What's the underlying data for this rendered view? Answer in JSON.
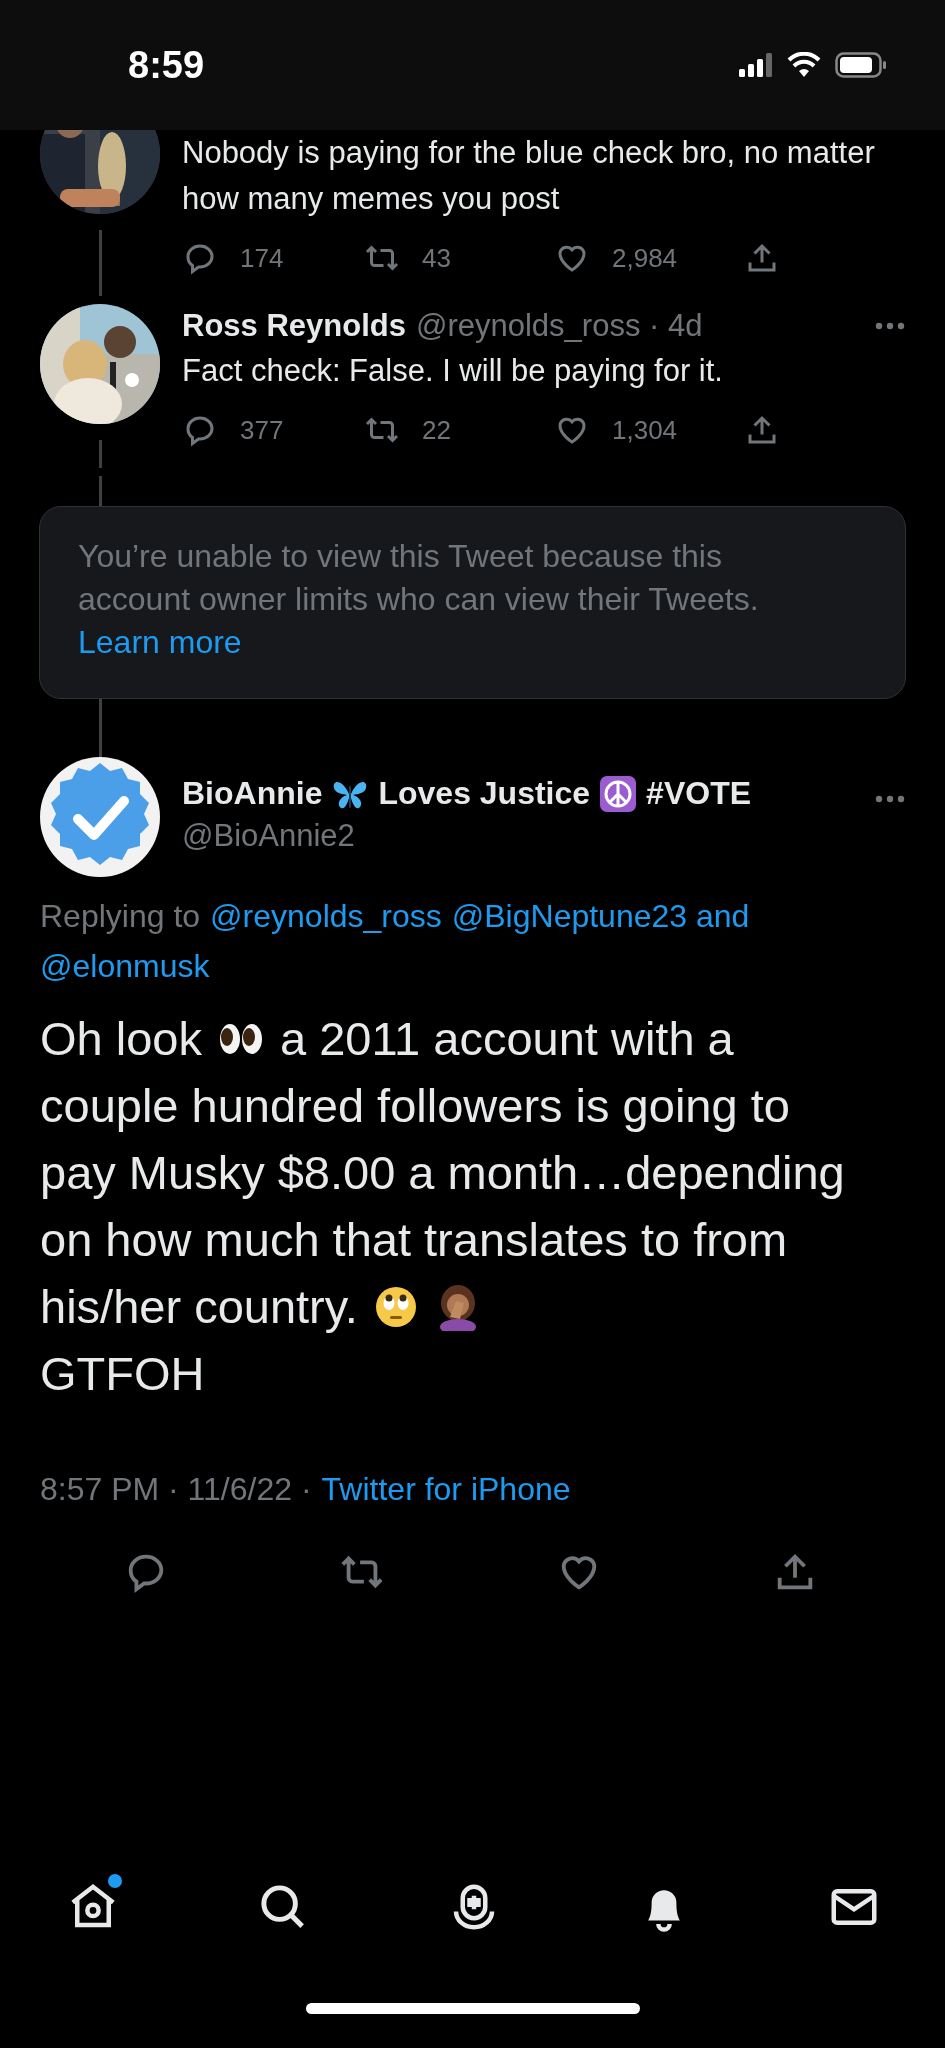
{
  "status_bar": {
    "time": "8:59"
  },
  "thread": [
    {
      "kind": "cut",
      "text": "Nobody is paying for the blue check bro, no matter how many memes you post",
      "replies": "174",
      "retweets": "43",
      "likes": "2,984"
    },
    {
      "kind": "full",
      "name": "Ross Reynolds",
      "meta": "@reynolds_ross · 4d",
      "text": "Fact check: False. I will be paying for it.",
      "replies": "377",
      "retweets": "22",
      "likes": "1,304"
    }
  ],
  "notice": {
    "text": "You’re unable to view this Tweet because this account owner limits who can view their Tweets.",
    "link": "Learn more"
  },
  "main_tweet": {
    "name_parts": [
      {
        "kind": "text",
        "text": "BioAnnie"
      },
      {
        "kind": "butterfly"
      },
      {
        "kind": "text",
        "text": "Loves Justice"
      },
      {
        "kind": "peace"
      },
      {
        "kind": "text",
        "text": "#VOTE"
      }
    ],
    "handle": "@BioAnnie2",
    "replying_label": "Replying to",
    "mentions": [
      "@reynolds_ross",
      "@BigNeptune23 and",
      "@elonmusk"
    ],
    "body_lines": [
      [
        {
          "kind": "text",
          "text": "Oh look"
        },
        {
          "kind": "eyes"
        },
        {
          "kind": "text",
          "text": "a 2011 account with a"
        }
      ],
      [
        {
          "kind": "text",
          "text": "couple hundred followers is going to"
        }
      ],
      [
        {
          "kind": "text",
          "text": "pay Musky $8.00 a month…depending"
        }
      ],
      [
        {
          "kind": "text",
          "text": "on how much that translates to from"
        }
      ],
      [
        {
          "kind": "text",
          "text": "his/her country."
        },
        {
          "kind": "rolling-eyes"
        },
        {
          "kind": "facepalm"
        }
      ],
      [
        {
          "kind": "text",
          "text": "GTFOH"
        }
      ]
    ],
    "timestamp": "8:57 PM · 11/6/22 ·",
    "source": "Twitter for iPhone"
  },
  "tab_bar": [
    {
      "kind": "home",
      "dot": true
    },
    {
      "kind": "search",
      "dot": false
    },
    {
      "kind": "spaces",
      "dot": false
    },
    {
      "kind": "notifications",
      "dot": false
    },
    {
      "kind": "messages",
      "dot": false
    }
  ]
}
